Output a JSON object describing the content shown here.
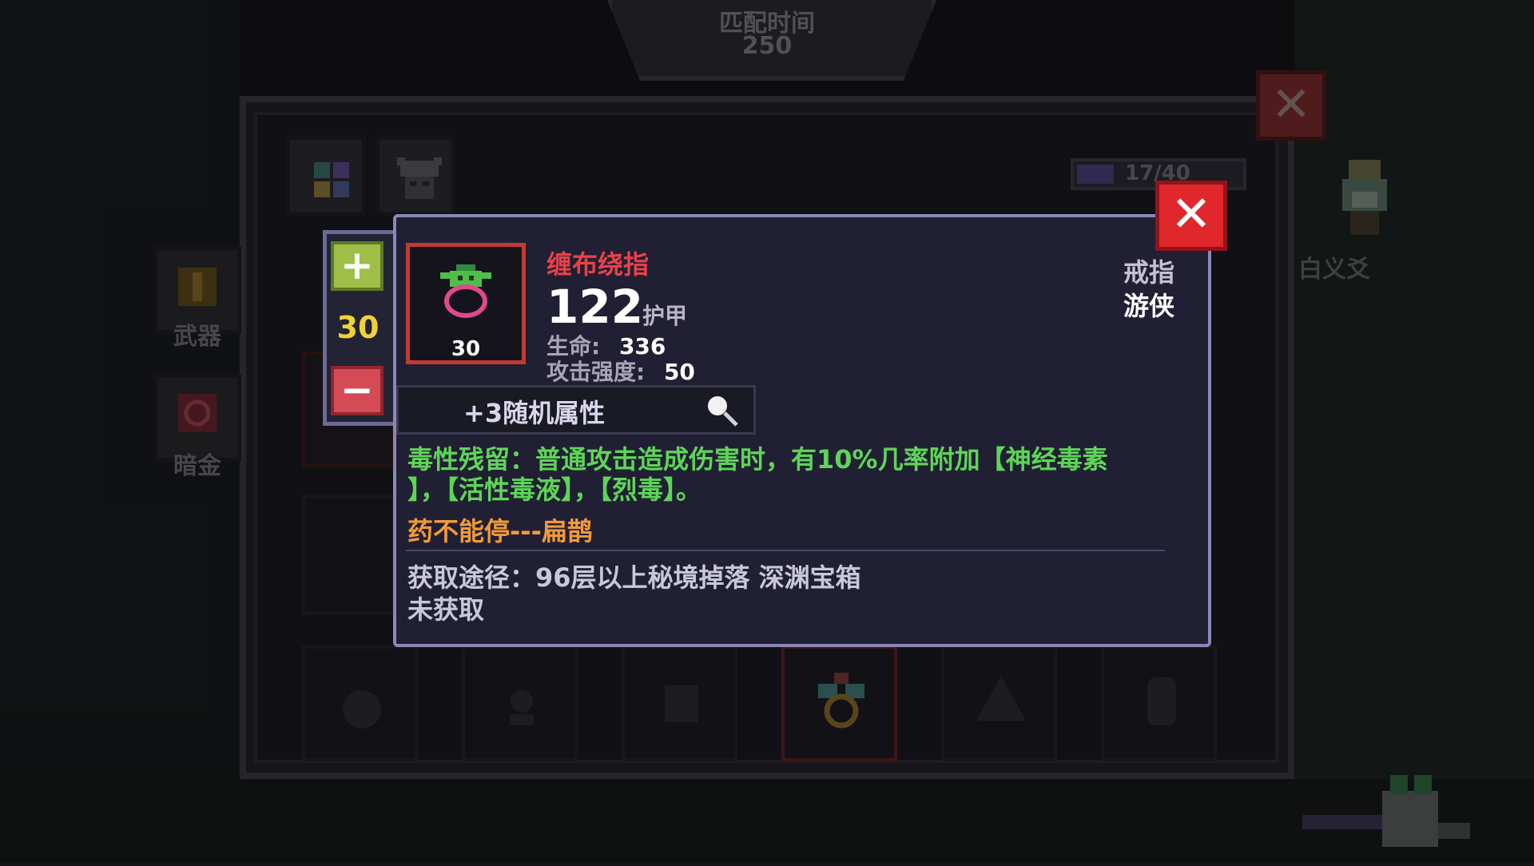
{
  "match": {
    "title": "匹配时间",
    "value": "250"
  },
  "inventory": {
    "capacity_text": "17/40",
    "categories": [
      {
        "label": "武器"
      },
      {
        "label": "暗金"
      }
    ],
    "npc_name": "白义爻",
    "tabs": [
      "grid-tab",
      "character-tab"
    ]
  },
  "stepper": {
    "plus": "+",
    "quantity": "30",
    "minus": "−"
  },
  "item": {
    "name": "缠布绕指",
    "level": "30",
    "armor_value": "122",
    "armor_label": "护甲",
    "stats": [
      {
        "label": "生命:",
        "value": "336"
      },
      {
        "label": "攻击强度:",
        "value": "50"
      }
    ],
    "type": "戒指",
    "class": "游侠",
    "random_attr": "+3随机属性",
    "description_line1": "毒性残留：普通攻击造成伤害时，有10%几率附加【神经毒素",
    "description_line2": "】，【活性毒液】，【烈毒】。",
    "quote": "药不能停---扁鹊",
    "source": "获取途径：96层以上秘境掉落 深渊宝箱",
    "status": "未获取"
  },
  "close_label": "✕",
  "colors": {
    "item_name": "#e8414a",
    "description": "#5ed558",
    "quote": "#f09a3a",
    "quantity": "#f2d233",
    "close": "#e0272c"
  }
}
